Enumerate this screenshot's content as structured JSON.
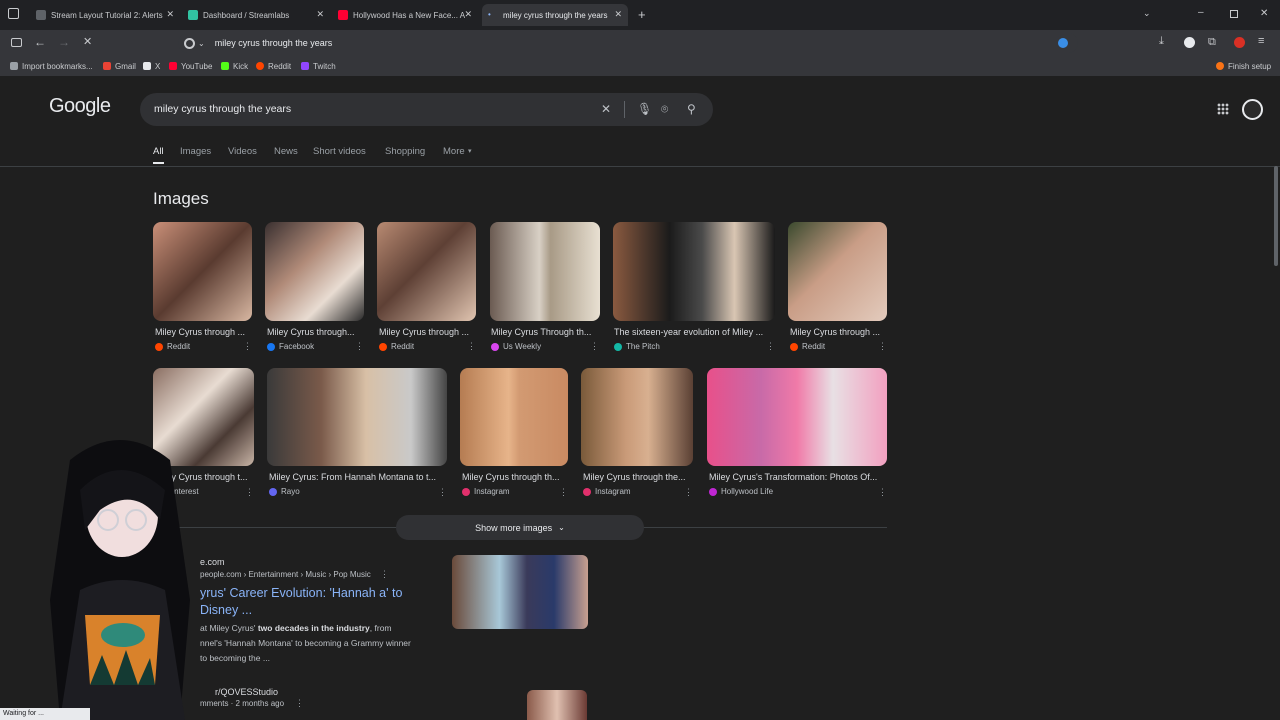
{
  "tabs": [
    {
      "label": "Stream Layout Tutorial 2: Alerts",
      "color": "#5f6368"
    },
    {
      "label": "Dashboard / Streamlabs",
      "color": "#31c3a2"
    },
    {
      "label": "Hollywood Has a New Face... A",
      "color": "#ff0033"
    },
    {
      "label": "miley cyrus through the years",
      "color": "#8ab4f8"
    }
  ],
  "address": {
    "value": "miley cyrus through the years"
  },
  "bookmarks": [
    {
      "label": "Import bookmarks...",
      "color": "#9aa0a6"
    },
    {
      "label": "Gmail",
      "color": "#ea4335"
    },
    {
      "label": "X",
      "color": "#e8eaed"
    },
    {
      "label": "YouTube",
      "color": "#ff0033"
    },
    {
      "label": "Kick",
      "color": "#53fc18"
    },
    {
      "label": "Reddit",
      "color": "#ff4500"
    },
    {
      "label": "Twitch",
      "color": "#9146ff"
    }
  ],
  "finish_setup": "Finish setup",
  "google": {
    "logo": "Google",
    "query": "miley cyrus through the years"
  },
  "nav": [
    "All",
    "Images",
    "Videos",
    "News",
    "Short videos",
    "Shopping",
    "More"
  ],
  "images_heading": "Images",
  "images_row1": [
    {
      "caption": "Miley Cyrus through ...",
      "source": "Reddit",
      "src_color": "#ff4500"
    },
    {
      "caption": "Miley Cyrus through...",
      "source": "Facebook",
      "src_color": "#1877f2"
    },
    {
      "caption": "Miley Cyrus through ...",
      "source": "Reddit",
      "src_color": "#ff4500"
    },
    {
      "caption": "Miley Cyrus Through th...",
      "source": "Us Weekly",
      "src_color": "#d946ef"
    },
    {
      "caption": "The sixteen-year evolution of Miley ...",
      "source": "The Pitch",
      "src_color": "#14b8a6"
    },
    {
      "caption": "Miley Cyrus through ...",
      "source": "Reddit",
      "src_color": "#ff4500"
    }
  ],
  "images_row2": [
    {
      "caption": "Miley Cyrus through t...",
      "source": "Pinterest",
      "src_color": "#e60023"
    },
    {
      "caption": "Miley Cyrus: From Hannah Montana to t...",
      "source": "Rayo",
      "src_color": "#6366f1"
    },
    {
      "caption": "Miley Cyrus through th...",
      "source": "Instagram",
      "src_color": "#e1306c"
    },
    {
      "caption": "Miley Cyrus through the...",
      "source": "Instagram",
      "src_color": "#e1306c"
    },
    {
      "caption": "Miley Cyrus's Transformation: Photos Of...",
      "source": "Hollywood Life",
      "src_color": "#c026d3"
    }
  ],
  "show_more": "Show more images",
  "result1": {
    "site": "e.com",
    "path": "people.com › Entertainment › Music › Pop Music",
    "title": "yrus' Career Evolution: 'Hannah a' to Disney ...",
    "snippet_a": "at Miley Cyrus'",
    "snippet_bold": "two decades in the industry",
    "snippet_b": ", from",
    "snippet_c": "nnel's 'Hannah Montana' to becoming a Grammy winner",
    "snippet_d": "to becoming the ..."
  },
  "result2": {
    "site": "r/QOVESStudio",
    "meta": "mments · 2 months ago"
  },
  "status": "Waiting for ..."
}
